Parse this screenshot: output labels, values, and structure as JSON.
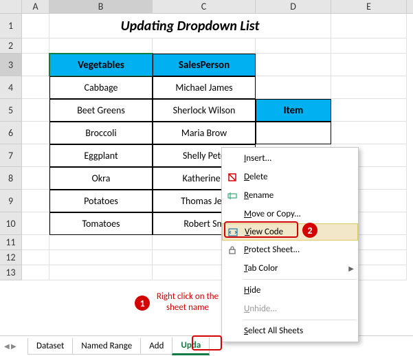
{
  "columns": {
    "A": "A",
    "B": "B",
    "C": "C",
    "D": "D",
    "E": "E"
  },
  "rows": [
    "1",
    "2",
    "3",
    "4",
    "5",
    "6",
    "7",
    "8",
    "9",
    "10",
    "11",
    "12",
    "13"
  ],
  "title": "Updating Dropdown List",
  "table": {
    "headers": {
      "veg": "Vegetables",
      "sales": "SalesPerson"
    },
    "data": [
      {
        "veg": "Cabbage",
        "sales": "Michael James"
      },
      {
        "veg": "Beet Greens",
        "sales": "Sherlock Wilson"
      },
      {
        "veg": "Broccoli",
        "sales": "Maria Brow"
      },
      {
        "veg": "Eggplant",
        "sales": "Shelly Pete"
      },
      {
        "veg": "Okra",
        "sales": "Katherine J"
      },
      {
        "veg": "Potatoes",
        "sales": "Thomas Jeff"
      },
      {
        "veg": "Tomatoes",
        "sales": "Robert Sm"
      }
    ]
  },
  "side_header": "Item",
  "context_menu": {
    "insert": "Insert...",
    "delete": "Delete",
    "rename": "Rename",
    "move": "Move or Copy...",
    "view_code": "View Code",
    "protect": "Protect Sheet...",
    "tab_color": "Tab Color",
    "hide": "Hide",
    "unhide": "Unhide...",
    "select_all": "Select All Sheets"
  },
  "tabs": {
    "dataset": "Dataset",
    "named_range": "Named Range",
    "add": "Add",
    "update": "Upda"
  },
  "annotations": {
    "step1_badge": "1",
    "step2_badge": "2",
    "step1_text": "Right click on the sheet name"
  }
}
